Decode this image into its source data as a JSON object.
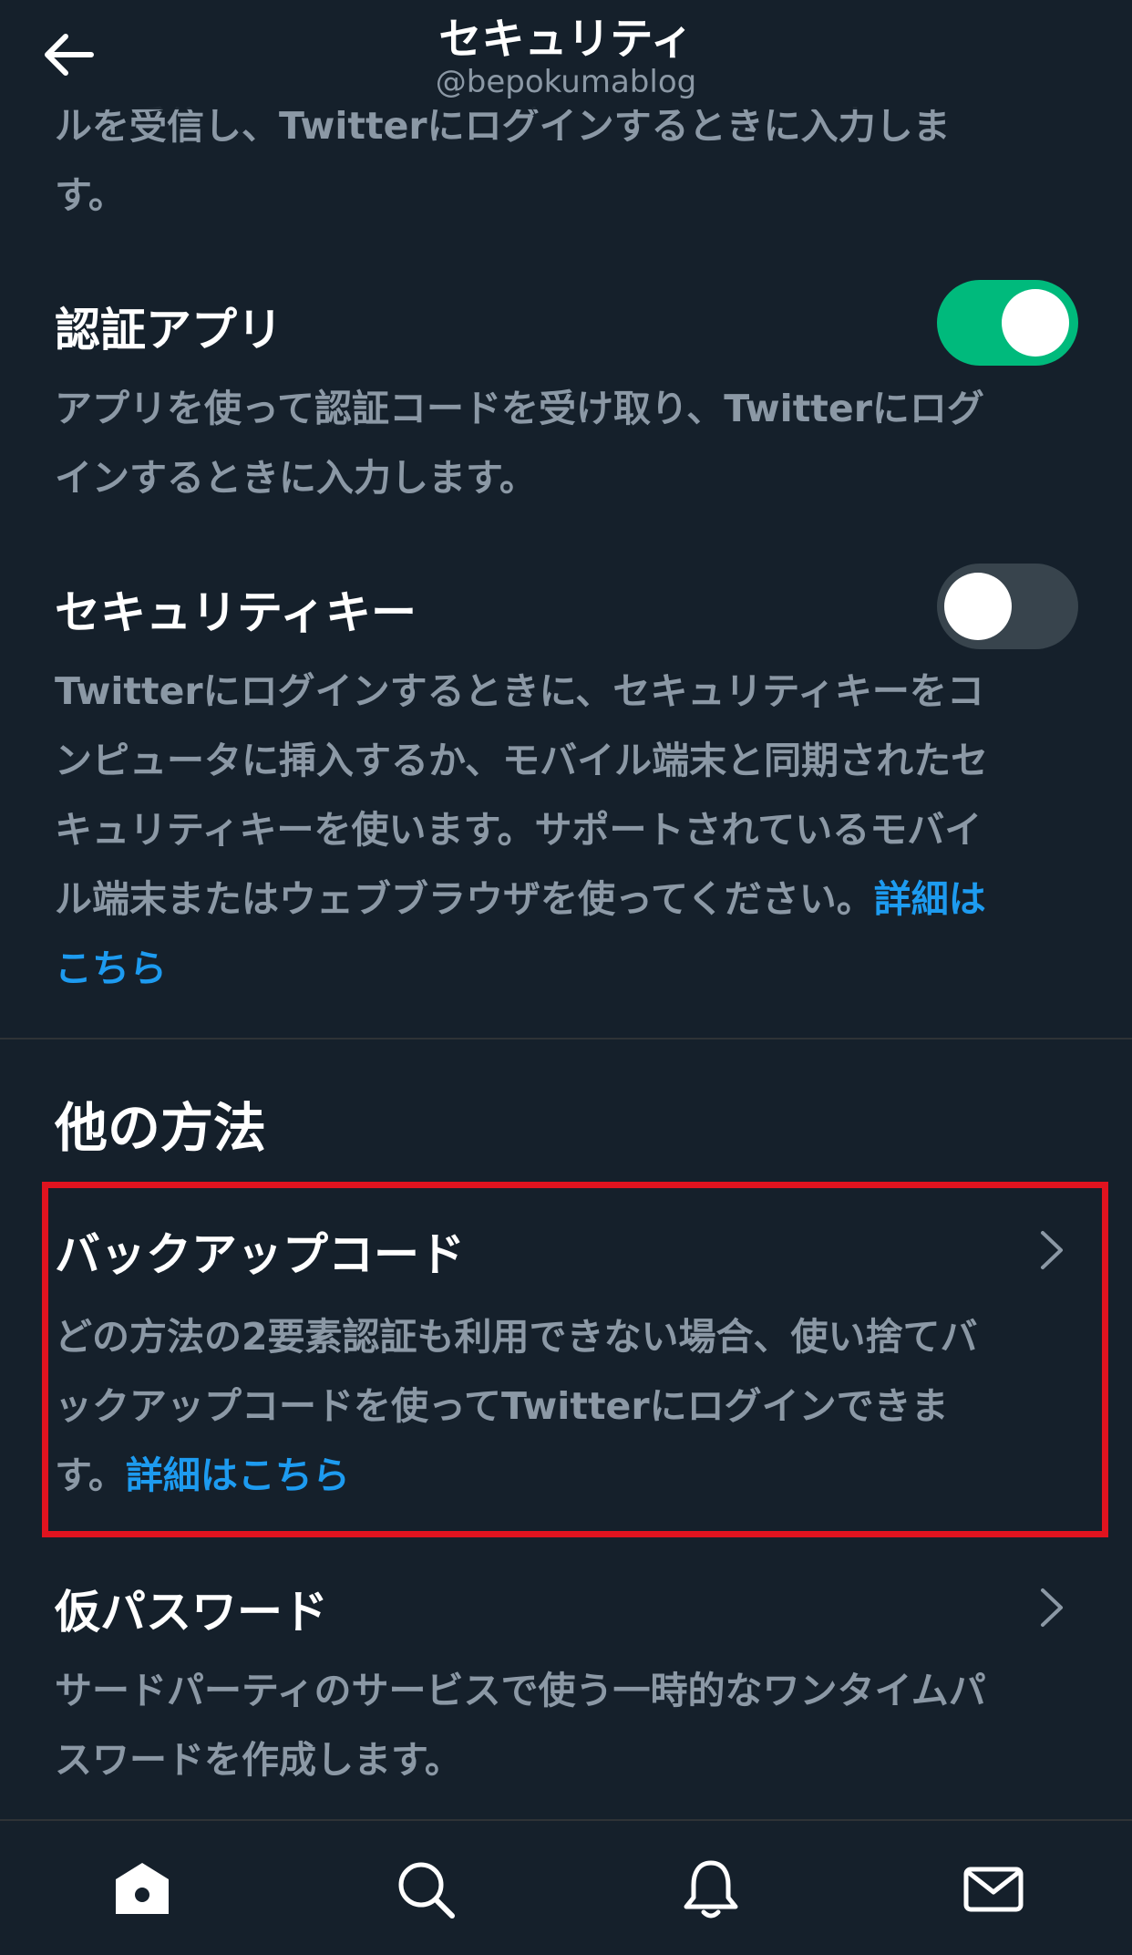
{
  "header": {
    "title": "セキュリティ",
    "handle": "@bepokumablog"
  },
  "sms_fragment": {
    "line1": "ルを受信し、Twitterにログインするときに入力しま",
    "line2": "す。"
  },
  "auth_app": {
    "title": "認証アプリ",
    "enabled": true,
    "desc_line1": "アプリを使って認証コードを受け取り、Twitterにログ",
    "desc_line2": "インするときに入力します。"
  },
  "security_key": {
    "title": "セキュリティキー",
    "enabled": false,
    "desc_line1": "Twitterにログインするときに、セキュリティキーをコ",
    "desc_line2": "ンピュータに挿入するか、モバイル端末と同期されたセ",
    "desc_line3": "キュリティキーを使います。サポートされているモバイ",
    "desc_line4": "ル端末またはウェブブラウザを使ってください。",
    "link_part1": "詳細は",
    "link_part2": "こちら"
  },
  "other_methods": {
    "heading": "他の方法",
    "backup": {
      "title": "バックアップコード",
      "desc_line1": "どの方法の2要素認証も利用できない場合、使い捨てバ",
      "desc_line2": "ックアップコードを使ってTwitterにログインできま",
      "desc_line3": "す。",
      "link": "詳細はこちら"
    },
    "temp_password": {
      "title": "仮パスワード",
      "desc_line1": "サードパーティのサービスで使う一時的なワンタイムパ",
      "desc_line2": "スワードを作成します。"
    }
  },
  "colors": {
    "background": "#15202b",
    "accent": "#1d9bf0",
    "toggle_on": "#00ba7c",
    "highlight": "#e0131f",
    "secondary_text": "#8b98a5"
  },
  "tabbar": {
    "icons": [
      "home-icon",
      "search-icon",
      "notifications-icon",
      "messages-icon"
    ]
  }
}
